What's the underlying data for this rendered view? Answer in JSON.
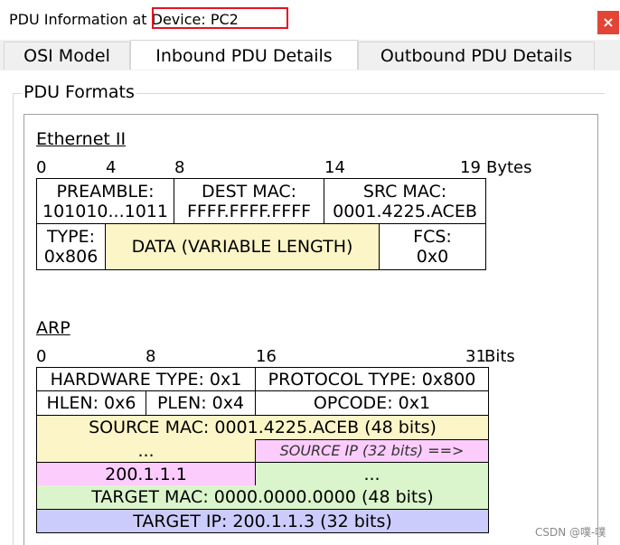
{
  "window": {
    "title_prefix": "PDU Information at ",
    "title_device": "Device: PC2",
    "close_glyph": "×"
  },
  "tabs": [
    {
      "label": "OSI Model",
      "active": false
    },
    {
      "label": "Inbound PDU Details",
      "active": true
    },
    {
      "label": "Outbound PDU Details",
      "active": false
    }
  ],
  "group_label": "PDU Formats",
  "ethernet": {
    "heading": "Ethernet II",
    "offsets": [
      "0",
      "4",
      "8",
      "14",
      "19"
    ],
    "unit": "Bytes",
    "preamble_label": "PREAMBLE:",
    "preamble_value": "101010...1011",
    "dest_label": "DEST MAC:",
    "dest_value": "FFFF.FFFF.FFFF",
    "src_label": "SRC MAC:",
    "src_value": "0001.4225.ACEB",
    "type_label": "TYPE:",
    "type_value": "0x806",
    "data_label": "DATA (VARIABLE LENGTH)",
    "fcs_label": "FCS:",
    "fcs_value": "0x0"
  },
  "arp": {
    "heading": "ARP",
    "offsets": [
      "0",
      "8",
      "16",
      "31"
    ],
    "unit": "Bits",
    "hardware_type": "HARDWARE TYPE: 0x1",
    "protocol_type": "PROTOCOL TYPE: 0x800",
    "hlen": "HLEN: 0x6",
    "plen": "PLEN: 0x4",
    "opcode": "OPCODE: 0x1",
    "source_mac": "SOURCE MAC: 0001.4225.ACEB (48 bits)",
    "source_mac_cont": "...",
    "source_ip_hint": "SOURCE IP (32 bits) ==>",
    "source_ip_value": "200.1.1.1",
    "target_mac_cont": "...",
    "target_mac": "TARGET MAC: 0000.0000.0000 (48 bits)",
    "target_ip": "TARGET IP: 200.1.1.3 (32 bits)"
  },
  "watermark": "CSDN @噗-噗",
  "colors": {
    "close_bg": "#e24536",
    "highlight_border": "#e81123",
    "yellow": "#fcf5c7",
    "pink": "#fcccfc",
    "green": "#daf5cc",
    "blue": "#ccccfc"
  }
}
